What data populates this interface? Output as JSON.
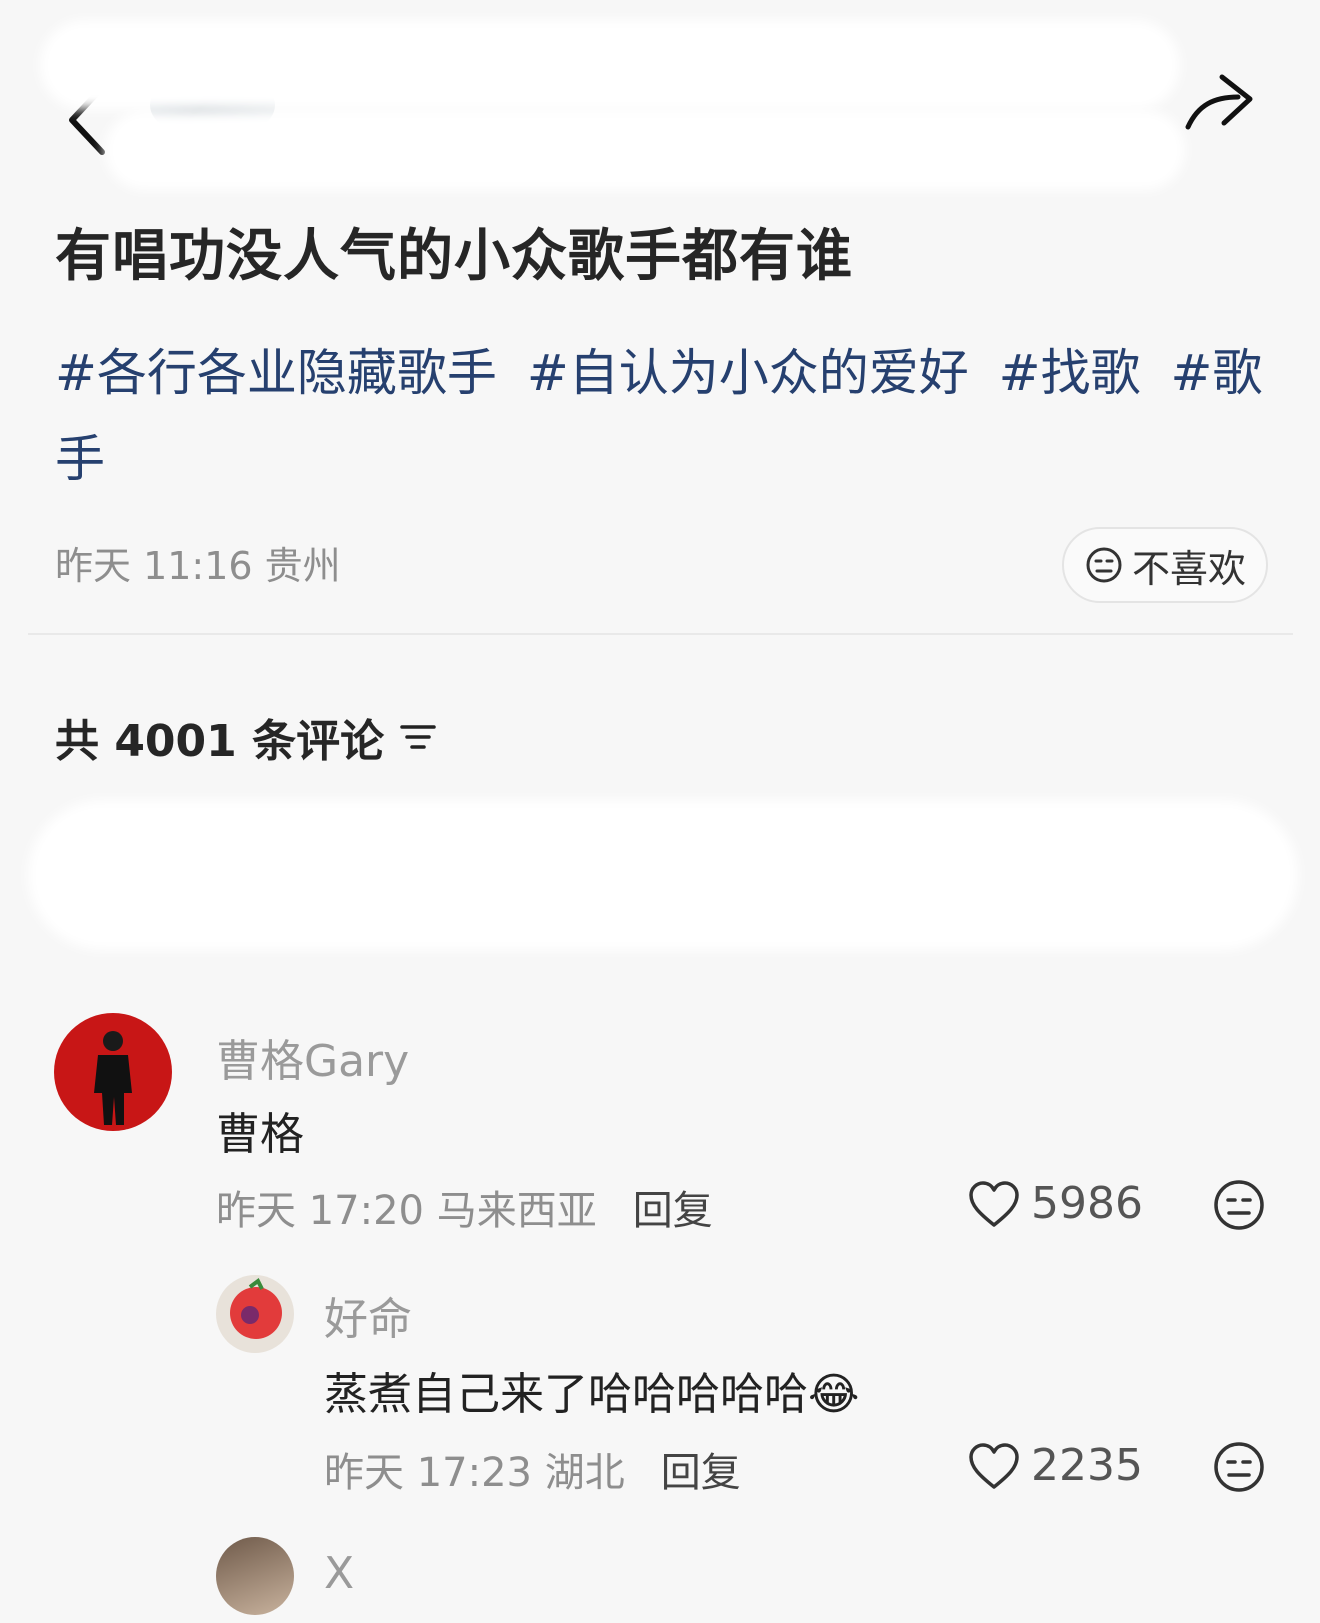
{
  "post": {
    "title": "有唱功没人气的小众歌手都有谁",
    "tags": [
      "#各行各业隐藏歌手",
      "#自认为小众的爱好",
      "#找歌",
      "#歌手"
    ],
    "meta": "昨天 11:16 贵州",
    "dislike_label": "不喜欢"
  },
  "comments_header": {
    "count_label": "共 4001 条评论"
  },
  "comments": [
    {
      "user": "曹格Gary",
      "text": "曹格",
      "meta": "昨天 17:20 马来西亚",
      "reply_label": "回复",
      "likes": "5986"
    },
    {
      "user": "好命",
      "text": "蒸煮自己来了哈哈哈哈哈",
      "emoji": "😂",
      "meta": "昨天 17:23 湖北",
      "reply_label": "回复",
      "likes": "2235"
    },
    {
      "user": "X"
    }
  ],
  "colors": {
    "tag": "#26406f",
    "background": "#f7f7f7"
  }
}
